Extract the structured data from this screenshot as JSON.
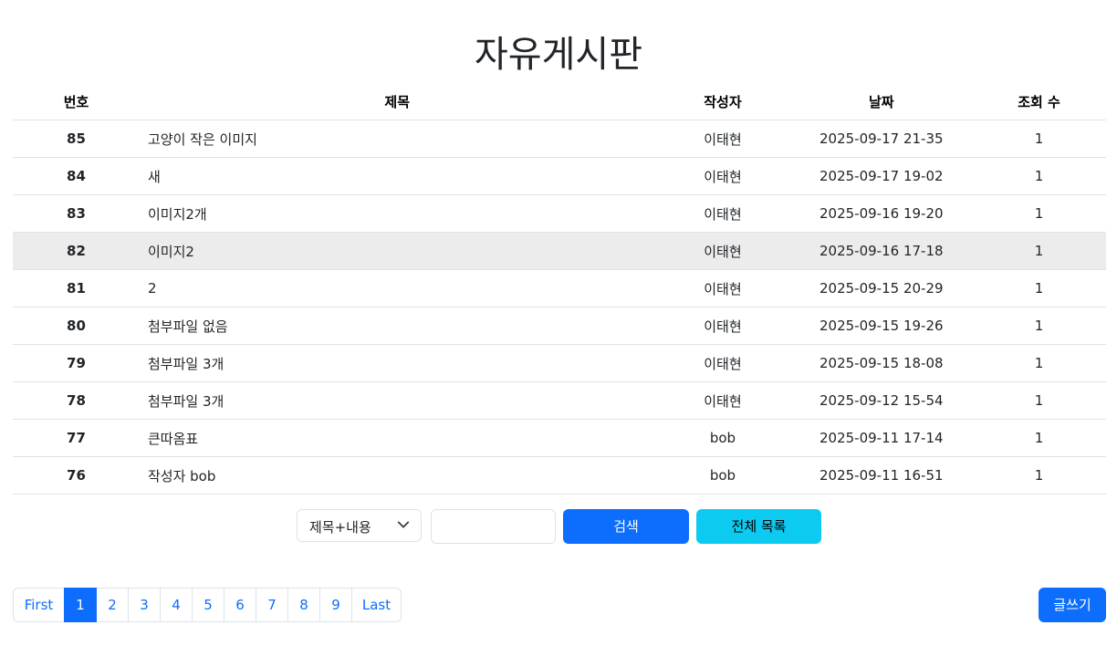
{
  "page_title": "자유게시판",
  "table": {
    "headers": {
      "no": "번호",
      "title": "제목",
      "author": "작성자",
      "date": "날짜",
      "views": "조회 수"
    },
    "rows": [
      {
        "no": "85",
        "title": "고양이 작은 이미지",
        "author": "이태현",
        "date": "2025-09-17 21-35",
        "views": "1"
      },
      {
        "no": "84",
        "title": "새",
        "author": "이태현",
        "date": "2025-09-17 19-02",
        "views": "1"
      },
      {
        "no": "83",
        "title": "이미지2개",
        "author": "이태현",
        "date": "2025-09-16 19-20",
        "views": "1"
      },
      {
        "no": "82",
        "title": "이미지2",
        "author": "이태현",
        "date": "2025-09-16 17-18",
        "views": "1"
      },
      {
        "no": "81",
        "title": "2",
        "author": "이태현",
        "date": "2025-09-15 20-29",
        "views": "1"
      },
      {
        "no": "80",
        "title": "첨부파일 없음",
        "author": "이태현",
        "date": "2025-09-15 19-26",
        "views": "1"
      },
      {
        "no": "79",
        "title": "첨부파일 3개",
        "author": "이태현",
        "date": "2025-09-15 18-08",
        "views": "1"
      },
      {
        "no": "78",
        "title": "첨부파일 3개",
        "author": "이태현",
        "date": "2025-09-12 15-54",
        "views": "1"
      },
      {
        "no": "77",
        "title": "큰따옴표",
        "author": "bob",
        "date": "2025-09-11 17-14",
        "views": "1"
      },
      {
        "no": "76",
        "title": "작성자 bob",
        "author": "bob",
        "date": "2025-09-11 16-51",
        "views": "1"
      }
    ]
  },
  "search": {
    "select_value": "제목+내용",
    "input_value": "",
    "search_button": "검색",
    "all_list_button": "전체 목록"
  },
  "pagination": {
    "first": "First",
    "pages": [
      "1",
      "2",
      "3",
      "4",
      "5",
      "6",
      "7",
      "8",
      "9"
    ],
    "active_page": "1",
    "last": "Last"
  },
  "write_button": "글쓰기",
  "colors": {
    "primary": "#0d6efd",
    "info": "#0dcaf0",
    "hover_row": "#ececec",
    "border": "#dee2e6"
  }
}
